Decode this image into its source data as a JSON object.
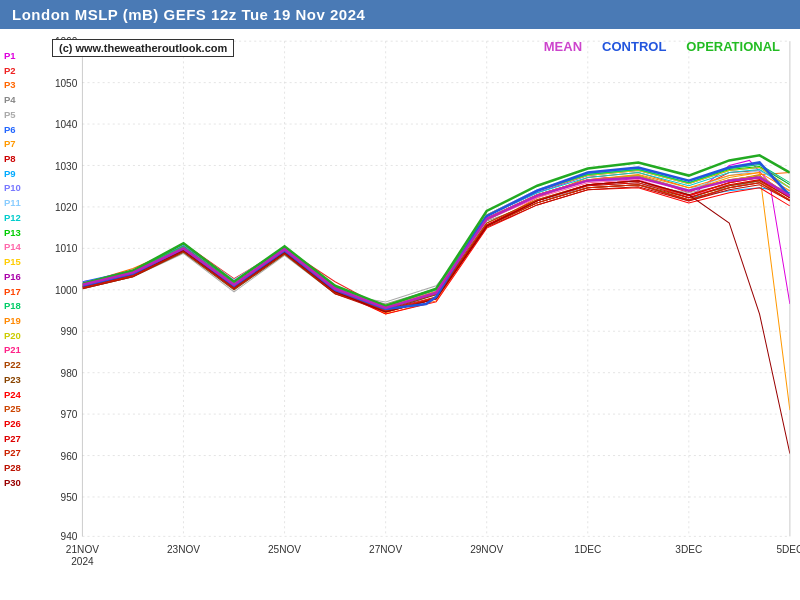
{
  "header": {
    "title": "London MSLP (mB) GEFS 12z Tue 19 Nov 2024"
  },
  "watermark": "(c) www.theweatheroutlook.com",
  "legend": {
    "mean_label": "MEAN",
    "control_label": "CONTROL",
    "operational_label": "OPERATIONAL",
    "mean_color": "#cc44cc",
    "control_color": "#2255dd",
    "operational_color": "#22bb22"
  },
  "y_axis": {
    "min": 940,
    "max": 1060,
    "labels": [
      940,
      950,
      960,
      970,
      980,
      990,
      1000,
      1010,
      1020,
      1030,
      1040,
      1050,
      1060
    ]
  },
  "x_axis": {
    "labels": [
      "21NOV\n2024",
      "23NOV",
      "25NOV",
      "27NOV",
      "29NOV",
      "1DEC",
      "3DEC",
      "5DEC"
    ]
  },
  "members": [
    {
      "name": "P1",
      "color": "#dd00dd"
    },
    {
      "name": "P2",
      "color": "#ee2222"
    },
    {
      "name": "P3",
      "color": "#ff6600"
    },
    {
      "name": "P4",
      "color": "#888888"
    },
    {
      "name": "P5",
      "color": "#aaaaaa"
    },
    {
      "name": "P6",
      "color": "#2266ff"
    },
    {
      "name": "P7",
      "color": "#ff9900"
    },
    {
      "name": "P8",
      "color": "#cc0000"
    },
    {
      "name": "P9",
      "color": "#00aaff"
    },
    {
      "name": "P10",
      "color": "#7777ff"
    },
    {
      "name": "P11",
      "color": "#88ccff"
    },
    {
      "name": "P12",
      "color": "#00cccc"
    },
    {
      "name": "P13",
      "color": "#00cc00"
    },
    {
      "name": "P14",
      "color": "#ff66aa"
    },
    {
      "name": "P15",
      "color": "#ffcc00"
    },
    {
      "name": "P16",
      "color": "#aa00aa"
    },
    {
      "name": "P17",
      "color": "#ff4400"
    },
    {
      "name": "P18",
      "color": "#00ff88"
    },
    {
      "name": "P19",
      "color": "#ff8800"
    },
    {
      "name": "P20",
      "color": "#cccc00"
    },
    {
      "name": "P21",
      "color": "#ff2288"
    },
    {
      "name": "P22",
      "color": "#aa4400"
    },
    {
      "name": "P23",
      "color": "#884400"
    },
    {
      "name": "P24",
      "color": "#ff0000"
    },
    {
      "name": "P25",
      "color": "#cc4400"
    },
    {
      "name": "P26",
      "color": "#ee0000"
    },
    {
      "name": "P27",
      "color": "#dd0000"
    },
    {
      "name": "P27b",
      "color": "#cc2200"
    },
    {
      "name": "P28",
      "color": "#bb1100"
    },
    {
      "name": "P30",
      "color": "#990000"
    }
  ]
}
